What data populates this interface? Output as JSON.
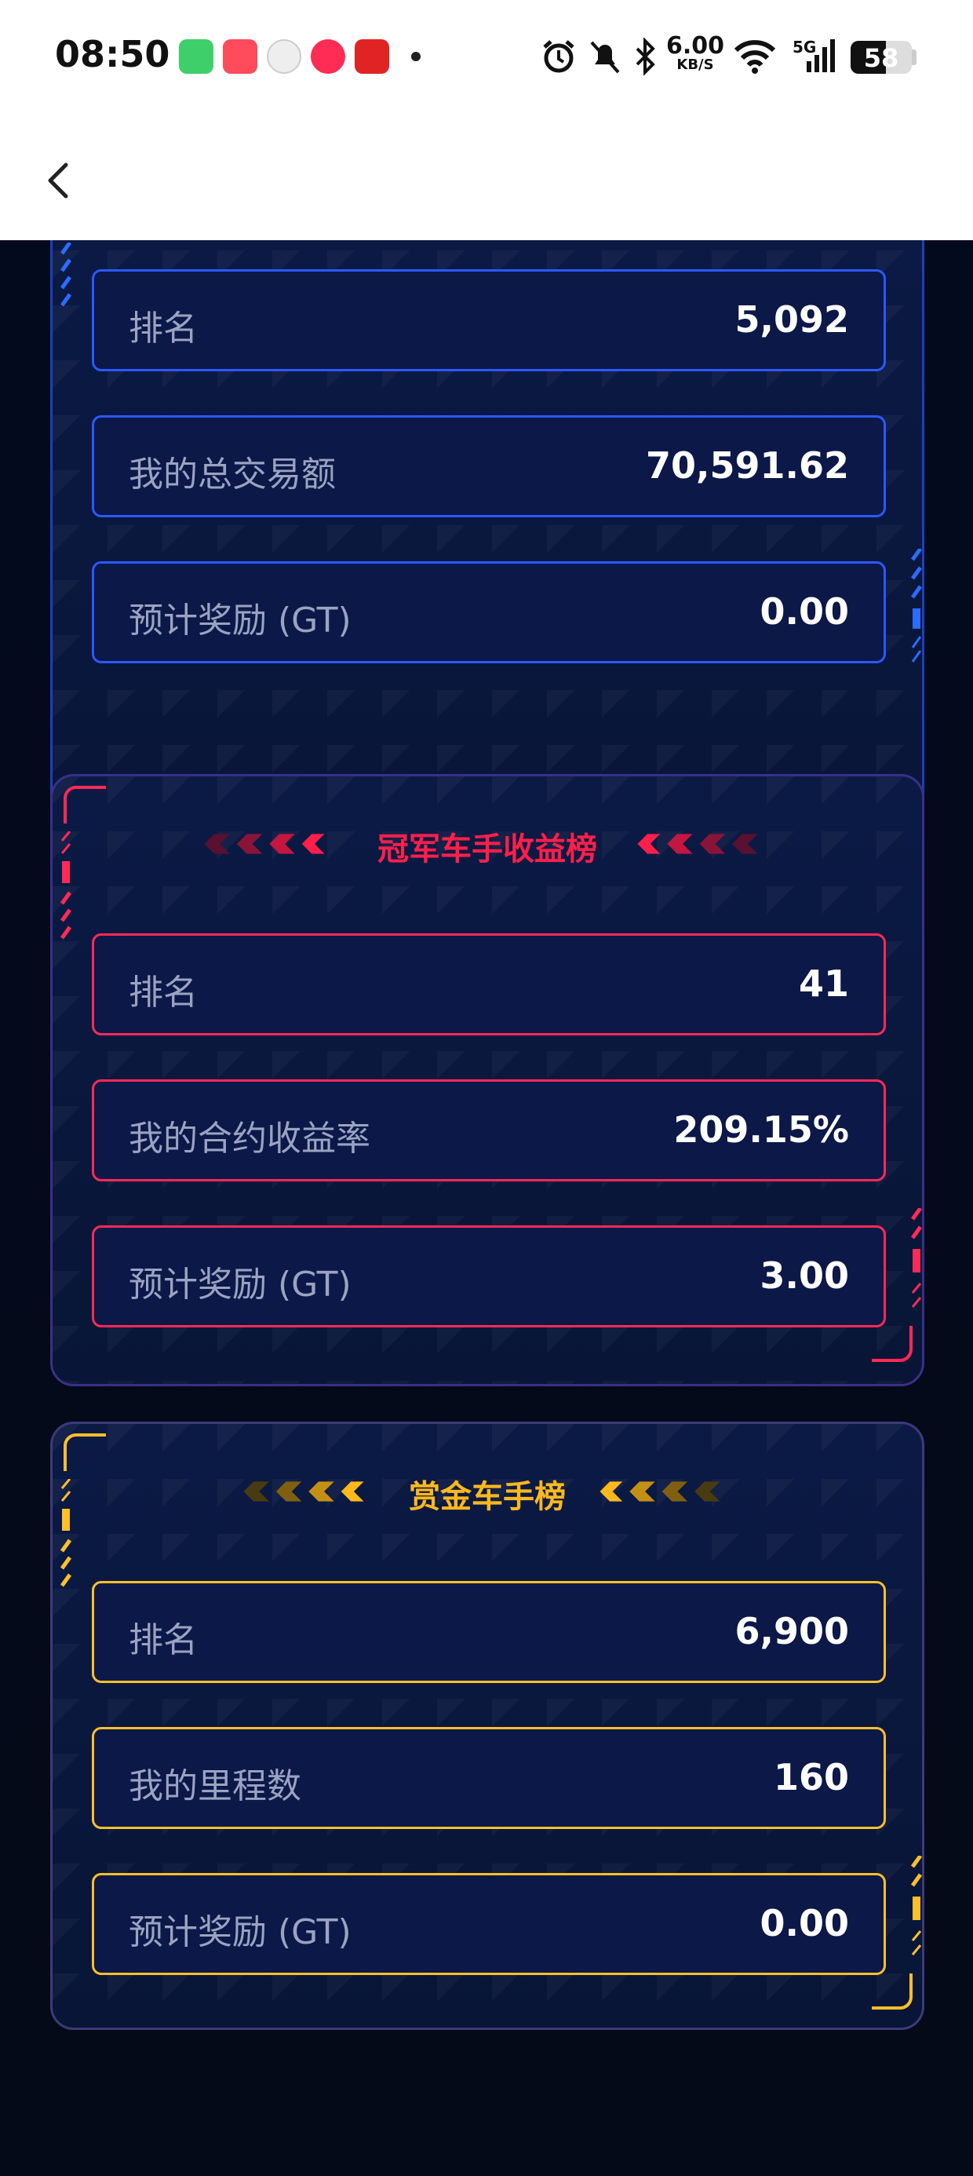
{
  "status": {
    "time": "08:50",
    "net_speed_value": "6.00",
    "net_speed_unit": "KB/S",
    "network": "5G",
    "battery": "58"
  },
  "cards": {
    "blue": {
      "rows": [
        {
          "label": "排名",
          "value": "5,092"
        },
        {
          "label": "我的总交易额",
          "value": "70,591.62"
        },
        {
          "label": "预计奖励 (GT)",
          "value": "0.00"
        }
      ]
    },
    "red": {
      "title": "冠军车手收益榜",
      "rows": [
        {
          "label": "排名",
          "value": "41"
        },
        {
          "label": "我的合约收益率",
          "value": "209.15%"
        },
        {
          "label": "预计奖励 (GT)",
          "value": "3.00"
        }
      ]
    },
    "gold": {
      "title": "赏金车手榜",
      "rows": [
        {
          "label": "排名",
          "value": "6,900"
        },
        {
          "label": "我的里程数",
          "value": "160"
        },
        {
          "label": "预计奖励 (GT)",
          "value": "0.00"
        }
      ]
    }
  },
  "colors": {
    "blue_accent": "#2c58ff",
    "red_accent": "#ff2a55",
    "gold_accent": "#ffbf2a",
    "background": "#050a18"
  }
}
